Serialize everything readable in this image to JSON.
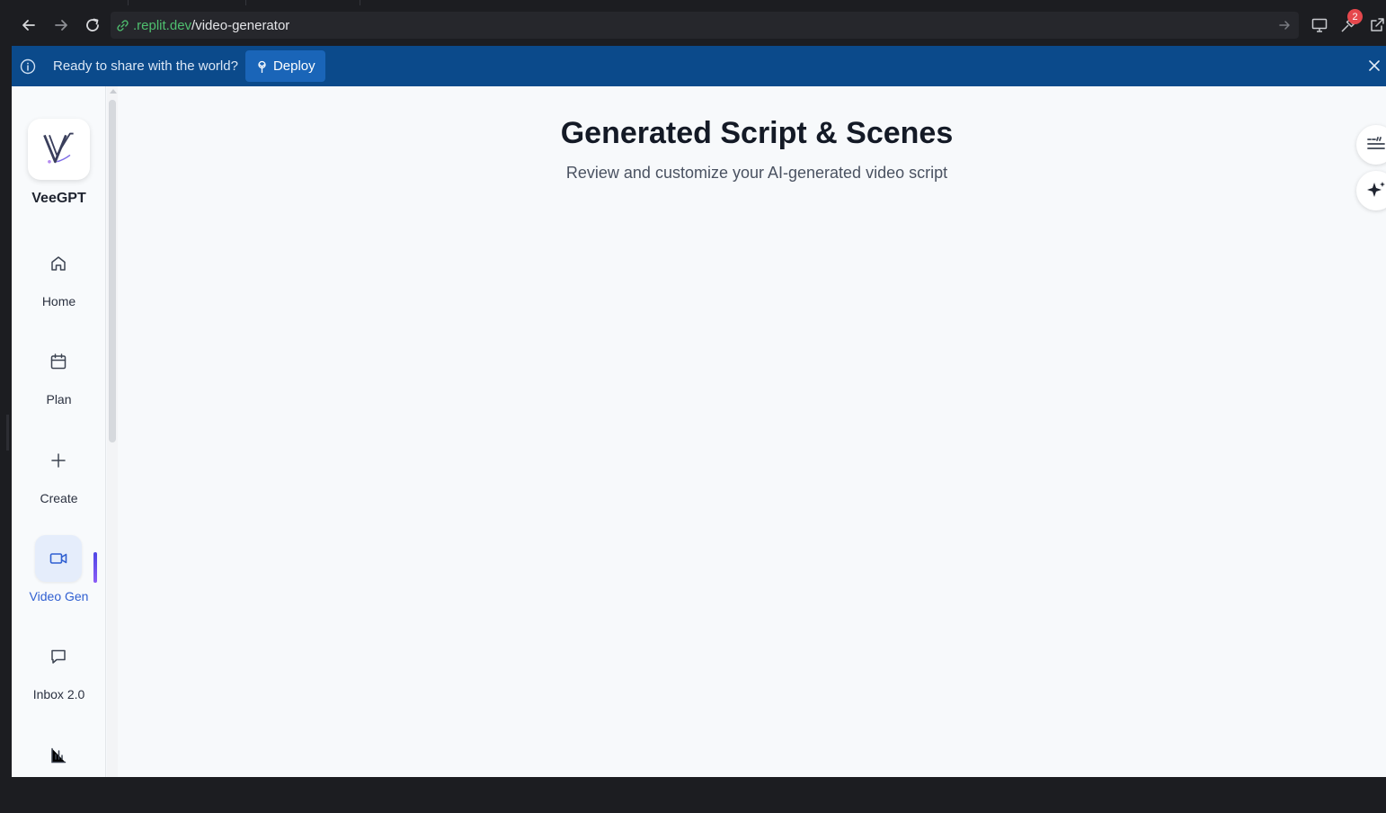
{
  "browser": {
    "url_domain": ".replit.dev",
    "url_path": "/video-generator",
    "notification_count": "2"
  },
  "banner": {
    "message": "Ready to share with the world?",
    "deploy_label": "Deploy"
  },
  "sidebar": {
    "brand": "VeeGPT",
    "items": [
      {
        "label": "Home",
        "icon": "home-icon"
      },
      {
        "label": "Plan",
        "icon": "calendar-icon"
      },
      {
        "label": "Create",
        "icon": "plus-icon"
      },
      {
        "label": "Video Gen",
        "icon": "video-camera-icon",
        "active": true
      },
      {
        "label": "Inbox 2.0",
        "icon": "chat-bubble-icon"
      },
      {
        "label": "",
        "icon": "bar-chart-icon"
      }
    ]
  },
  "main": {
    "title": "Generated Script & Scenes",
    "subtitle": "Review and customize your AI-generated video script"
  },
  "colors": {
    "banner_bg": "#0b4a8b",
    "deploy_button": "#1a65b8",
    "active_accent": "#2f5fd1",
    "url_domain": "#4fbf6f"
  }
}
